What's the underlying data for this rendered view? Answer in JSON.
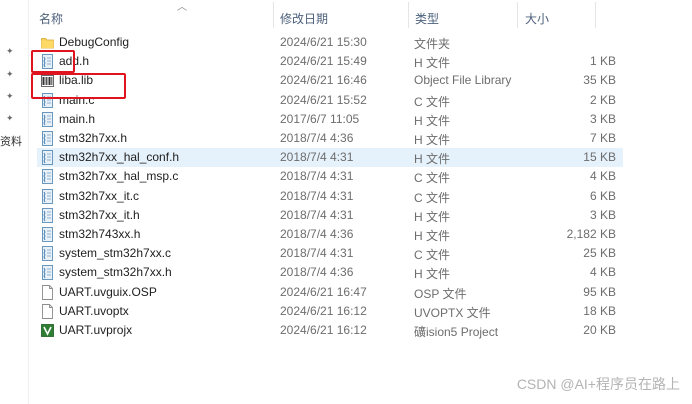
{
  "sidebar": {
    "truncated_label": "资料"
  },
  "columns": {
    "name": "名称",
    "date": "修改日期",
    "type": "类型",
    "size": "大小"
  },
  "files": [
    {
      "name": "DebugConfig",
      "date": "2024/6/21 15:30",
      "type": "文件夹",
      "size": "",
      "icon": "folder-icon"
    },
    {
      "name": "add.h",
      "date": "2024/6/21 15:49",
      "type": "H 文件",
      "size": "1 KB",
      "icon": "source-file-icon"
    },
    {
      "name": "liba.lib",
      "date": "2024/6/21 16:46",
      "type": "Object File Library",
      "size": "35 KB",
      "icon": "library-file-icon"
    },
    {
      "name": "main.c",
      "date": "2024/6/21 15:52",
      "type": "C 文件",
      "size": "2 KB",
      "icon": "source-file-icon"
    },
    {
      "name": "main.h",
      "date": "2017/6/7 11:05",
      "type": "H 文件",
      "size": "3 KB",
      "icon": "source-file-icon"
    },
    {
      "name": "stm32h7xx.h",
      "date": "2018/7/4 4:36",
      "type": "H 文件",
      "size": "7 KB",
      "icon": "source-file-icon"
    },
    {
      "name": "stm32h7xx_hal_conf.h",
      "date": "2018/7/4 4:31",
      "type": "H 文件",
      "size": "15 KB",
      "icon": "source-file-icon"
    },
    {
      "name": "stm32h7xx_hal_msp.c",
      "date": "2018/7/4 4:31",
      "type": "C 文件",
      "size": "4 KB",
      "icon": "source-file-icon"
    },
    {
      "name": "stm32h7xx_it.c",
      "date": "2018/7/4 4:31",
      "type": "C 文件",
      "size": "6 KB",
      "icon": "source-file-icon"
    },
    {
      "name": "stm32h7xx_it.h",
      "date": "2018/7/4 4:31",
      "type": "H 文件",
      "size": "3 KB",
      "icon": "source-file-icon"
    },
    {
      "name": "stm32h743xx.h",
      "date": "2018/7/4 4:36",
      "type": "H 文件",
      "size": "2,182 KB",
      "icon": "source-file-icon"
    },
    {
      "name": "system_stm32h7xx.c",
      "date": "2018/7/4 4:31",
      "type": "C 文件",
      "size": "25 KB",
      "icon": "source-file-icon"
    },
    {
      "name": "system_stm32h7xx.h",
      "date": "2018/7/4 4:36",
      "type": "H 文件",
      "size": "4 KB",
      "icon": "source-file-icon"
    },
    {
      "name": "UART.uvguix.OSP",
      "date": "2024/6/21 16:47",
      "type": "OSP 文件",
      "size": "95 KB",
      "icon": "blank-file-icon"
    },
    {
      "name": "UART.uvoptx",
      "date": "2024/6/21 16:12",
      "type": "UVOPTX 文件",
      "size": "18 KB",
      "icon": "blank-file-icon"
    },
    {
      "name": "UART.uvprojx",
      "date": "2024/6/21 16:12",
      "type": "礦ision5 Project",
      "size": "20 KB",
      "icon": "keil-project-icon"
    }
  ],
  "selected_index": 6,
  "highlighted": [
    "add.h",
    "liba.lib"
  ],
  "accent_color": "#e0141e",
  "watermark": "CSDN @AI+程序员在路上"
}
